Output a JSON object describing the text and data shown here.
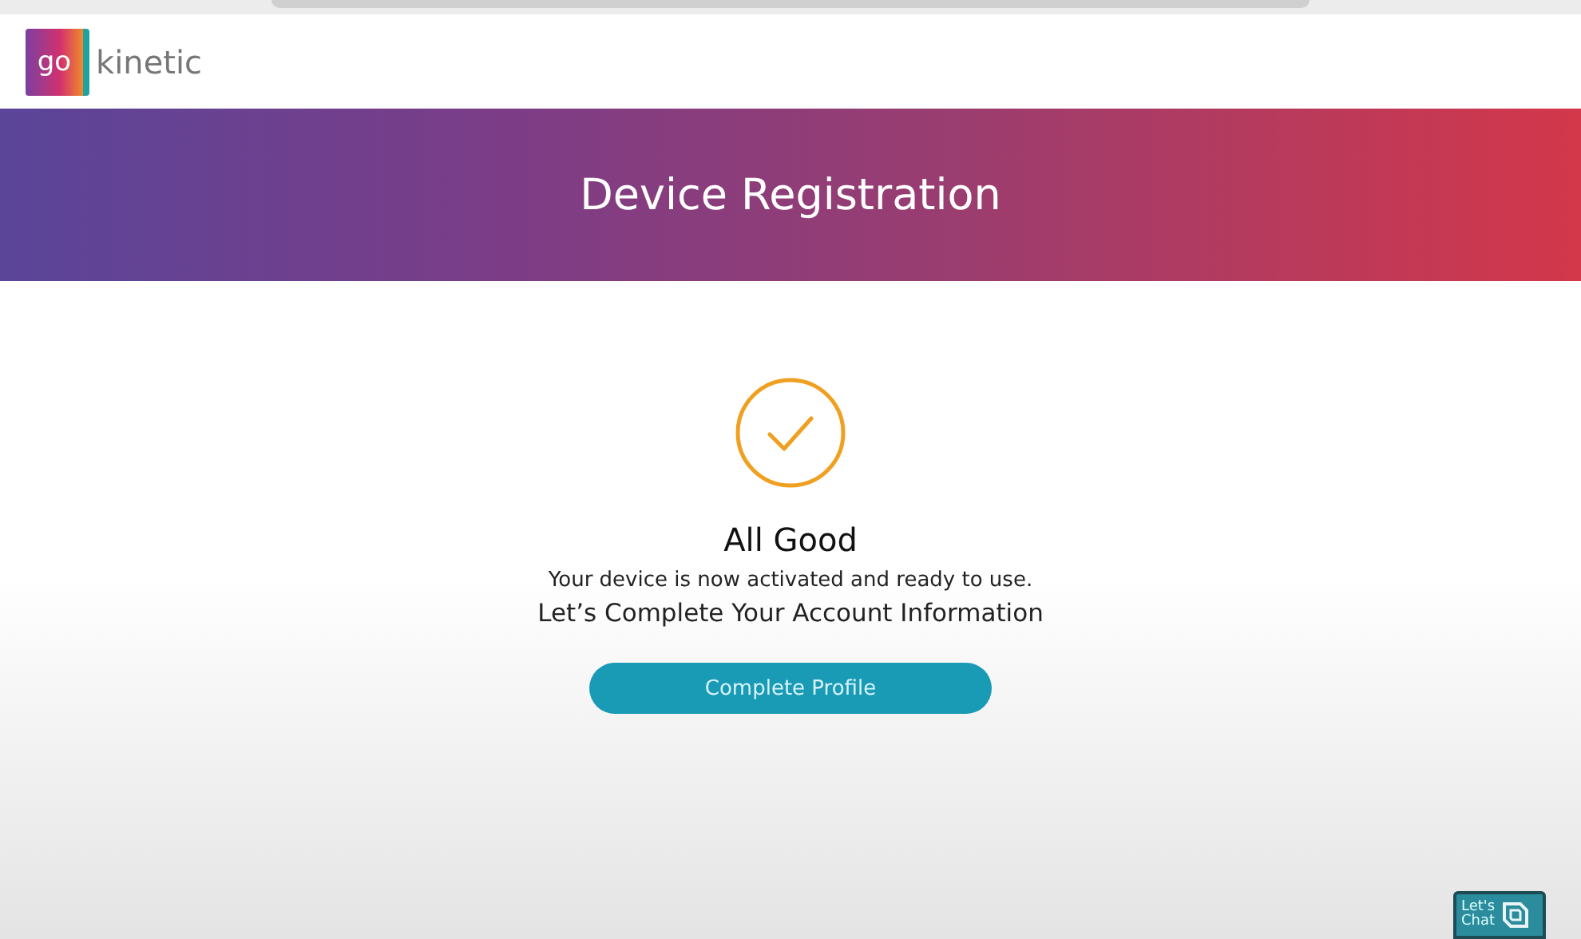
{
  "logo": {
    "mark": "go",
    "name": "kinetic"
  },
  "banner": {
    "title": "Device Registration"
  },
  "status": {
    "title": "All Good",
    "message": "Your device is now activated and ready to use.",
    "prompt": "Let’s Complete Your Account Information"
  },
  "buttons": [
    {
      "label": "Complete Profile"
    }
  ],
  "chat": {
    "label": "Let's Chat"
  }
}
